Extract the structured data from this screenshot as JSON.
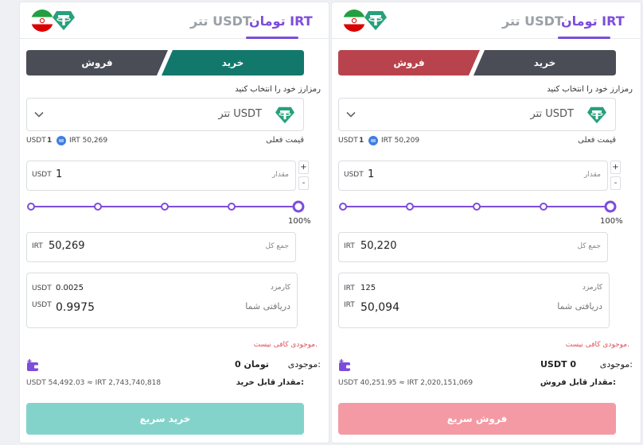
{
  "colors": {
    "accent_purple": "#7c4ddb",
    "buy_green": "#12786c",
    "sell_red": "#b8434c",
    "inactive_dark": "#4a4d55",
    "buy_cta_light": "#84d3cb",
    "sell_cta_light": "#f49aa4",
    "warning_red": "#e0505c",
    "tether_green": "#26a17b"
  },
  "panels": [
    {
      "mode": "buy",
      "tabs": {
        "irt_label": "تومان IRT",
        "usdt_label": "تتر USDT"
      },
      "side": {
        "buy_label": "خرید",
        "sell_label": "فروش",
        "active": "buy"
      },
      "select_hint": "رمزارز خود را انتخاب کنید",
      "selected_coin": "تتر  USDT",
      "coin_icon": "tether-icon",
      "price": {
        "label": "قیمت فعلی",
        "usdt_unit": "USDT",
        "usdt_value": "1",
        "irt_text": "IRT 50,269"
      },
      "amount": {
        "unit": "USDT",
        "value": "1",
        "label": "مقدار"
      },
      "slider": {
        "percent": 100,
        "value_label": "100%"
      },
      "total": {
        "unit": "IRT",
        "value": "50,269",
        "label": "جمع کل"
      },
      "fee": {
        "unit": "USDT",
        "value": "0.0025",
        "label": "کارمزد"
      },
      "receive": {
        "unit": "USDT",
        "value": "0.9975",
        "label": "دریافتی شما"
      },
      "warning": "موجودی کافی نیست.",
      "balance": {
        "label": "موجودی:",
        "value": "0  تومان"
      },
      "limit": {
        "label": "مقدار قابل خرید:",
        "value": "USDT 54,492.03 ≈ IRT 2,743,740,818"
      },
      "cta_label": "خرید سریع"
    },
    {
      "mode": "sell",
      "tabs": {
        "irt_label": "تومان IRT",
        "usdt_label": "تتر USDT"
      },
      "side": {
        "buy_label": "خرید",
        "sell_label": "فروش",
        "active": "sell"
      },
      "select_hint": "رمزارز خود را انتخاب کنید",
      "selected_coin": "تتر  USDT",
      "coin_icon": "tether-icon",
      "price": {
        "label": "قیمت فعلی",
        "usdt_unit": "USDT",
        "usdt_value": "1",
        "irt_text": "IRT 50,209"
      },
      "amount": {
        "unit": "USDT",
        "value": "1",
        "label": "مقدار"
      },
      "slider": {
        "percent": 100,
        "value_label": "100%"
      },
      "total": {
        "unit": "IRT",
        "value": "50,220",
        "label": "جمع کل"
      },
      "fee": {
        "unit": "IRT",
        "value": "125",
        "label": "کارمزد"
      },
      "receive": {
        "unit": "IRT",
        "value": "50,094",
        "label": "دریافتی شما"
      },
      "warning": "موجودی کافی نیست.",
      "balance": {
        "label": "موجودی:",
        "value": "USDT  0"
      },
      "limit": {
        "label": "مقدار قابل فروش:",
        "value": "USDT 40,251.95 ≈ IRT 2,020,151,069"
      },
      "cta_label": "فروش سریع"
    }
  ]
}
